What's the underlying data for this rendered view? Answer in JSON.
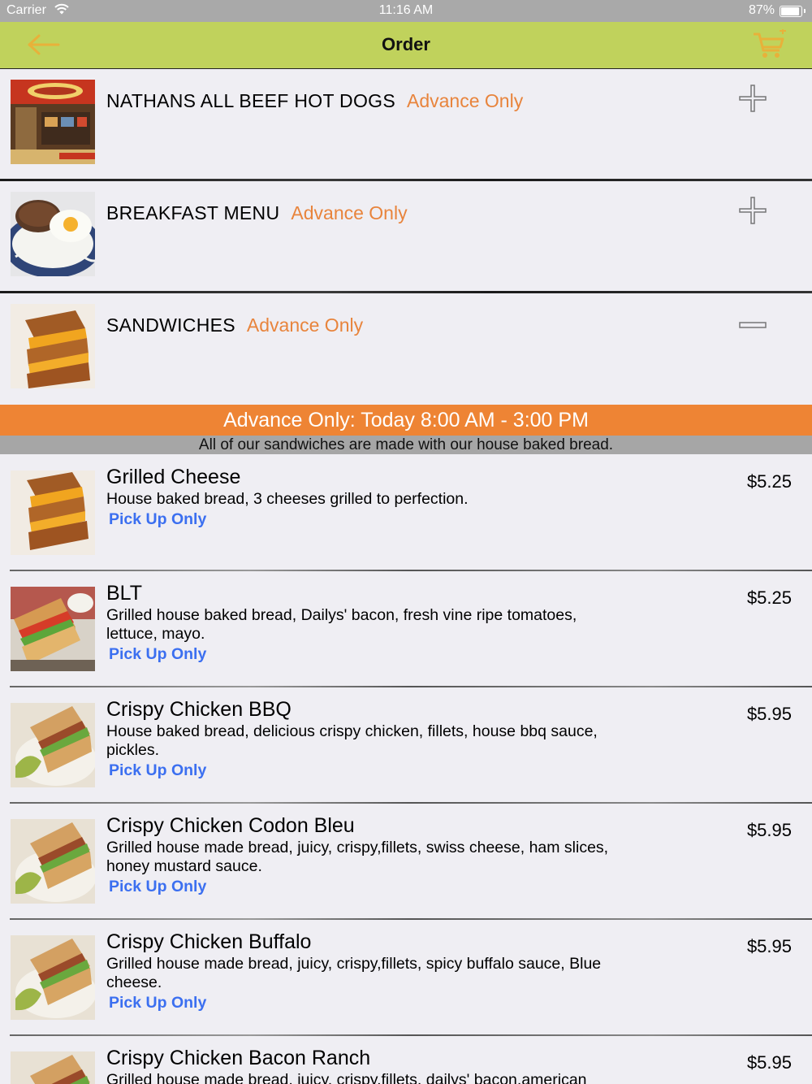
{
  "status_bar": {
    "carrier": "Carrier",
    "time": "11:16 AM",
    "battery": "87%",
    "battery_level": 0.87
  },
  "nav": {
    "title": "Order",
    "accent": "#c0d25c",
    "icon_color": "#e8b13a"
  },
  "categories": [
    {
      "name": "NATHANS ALL BEEF HOT DOGS",
      "tag": "Advance Only",
      "state": "collapsed",
      "icon": "plus-icon"
    },
    {
      "name": "BREAKFAST MENU",
      "tag": "Advance Only",
      "state": "collapsed",
      "icon": "plus-icon"
    },
    {
      "name": "SANDWICHES",
      "tag": "Advance Only",
      "state": "expanded",
      "icon": "minus-icon"
    }
  ],
  "availability": "Advance Only: Today 8:00 AM - 3:00 PM",
  "section_note": "All of our sandwiches are made with our house baked bread.",
  "items": [
    {
      "name": "Grilled Cheese",
      "description": "House baked bread, 3 cheeses grilled to perfection.",
      "pickup": "Pick Up Only",
      "price": "$5.25"
    },
    {
      "name": "BLT",
      "description": "Grilled house baked bread, Dailys' bacon, fresh vine ripe tomatoes, lettuce, mayo.",
      "pickup": "Pick Up Only",
      "price": "$5.25"
    },
    {
      "name": "Crispy Chicken BBQ",
      "description": "House baked bread, delicious crispy chicken, fillets, house bbq sauce, pickles.",
      "pickup": "Pick Up Only",
      "price": "$5.95"
    },
    {
      "name": "Crispy Chicken Codon Bleu",
      "description": "Grilled house made bread, juicy, crispy,fillets, swiss cheese, ham slices, honey mustard sauce.",
      "pickup": "Pick Up Only",
      "price": "$5.95"
    },
    {
      "name": "Crispy Chicken Buffalo",
      "description": "Grilled house made bread, juicy, crispy,fillets, spicy buffalo sauce, Blue cheese.",
      "pickup": "Pick Up Only",
      "price": "$5.95"
    },
    {
      "name": "Crispy Chicken Bacon Ranch",
      "description": "Grilled house made bread, juicy, crispy,fillets, dailys' bacon,american",
      "pickup": "",
      "price": "$5.95"
    }
  ]
}
